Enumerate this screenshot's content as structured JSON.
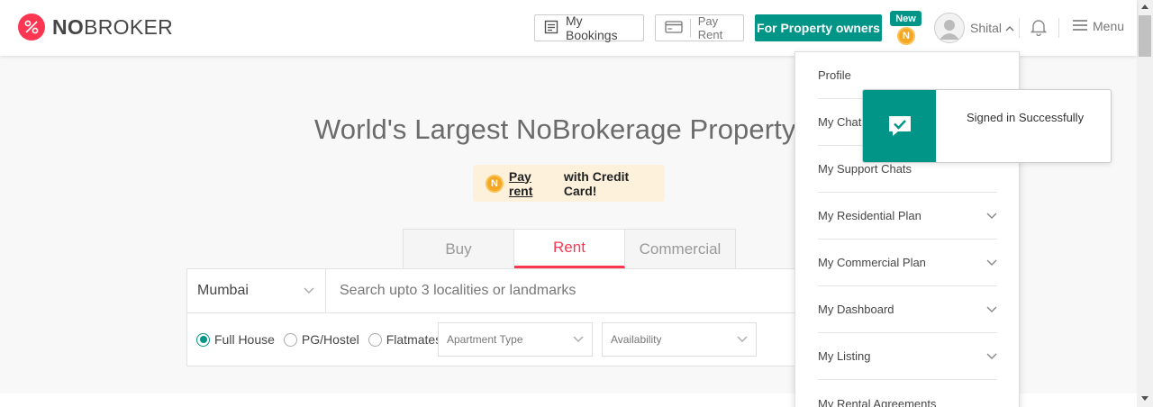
{
  "header": {
    "logo": {
      "bold": "NO",
      "rest": "BROKER"
    },
    "my_bookings_label": "My Bookings",
    "pay_rent_label": "Pay Rent",
    "owners_label": "For Property owners",
    "new_badge": "New",
    "coin_letter": "N",
    "user_name": "Shital",
    "menu_label": "Menu"
  },
  "hero": {
    "title": "World's Largest NoBrokerage Property S",
    "promo": {
      "coin_letter": "N",
      "link_text": "Pay rent",
      "rest_text": "with Credit Card!"
    }
  },
  "tabs": [
    {
      "label": "Buy",
      "active": false
    },
    {
      "label": "Rent",
      "active": true
    },
    {
      "label": "Commercial",
      "active": false
    }
  ],
  "search": {
    "city": "Mumbai",
    "placeholder": "Search upto 3 localities or landmarks",
    "radio_options": [
      {
        "label": "Full House",
        "selected": true
      },
      {
        "label": "PG/Hostel",
        "selected": false
      },
      {
        "label": "Flatmates",
        "selected": false
      }
    ],
    "apartment_type_placeholder": "Apartment Type",
    "availability_placeholder": "Availability"
  },
  "dropdown": {
    "items": [
      {
        "label": "Profile",
        "has_chevron": false
      },
      {
        "label": "My Chats",
        "has_chevron": false
      },
      {
        "label": "My Support Chats",
        "has_chevron": false
      },
      {
        "label": "My Residential Plan",
        "has_chevron": true
      },
      {
        "label": "My Commercial Plan",
        "has_chevron": true
      },
      {
        "label": "My Dashboard",
        "has_chevron": true
      },
      {
        "label": "My Listing",
        "has_chevron": true
      },
      {
        "label": "My Rental Agreements",
        "has_chevron": false
      }
    ]
  },
  "toast": {
    "message": "Signed in Successfully"
  },
  "colors": {
    "brand": "#fd3752",
    "teal": "#009587",
    "coin": "#f5a623"
  }
}
